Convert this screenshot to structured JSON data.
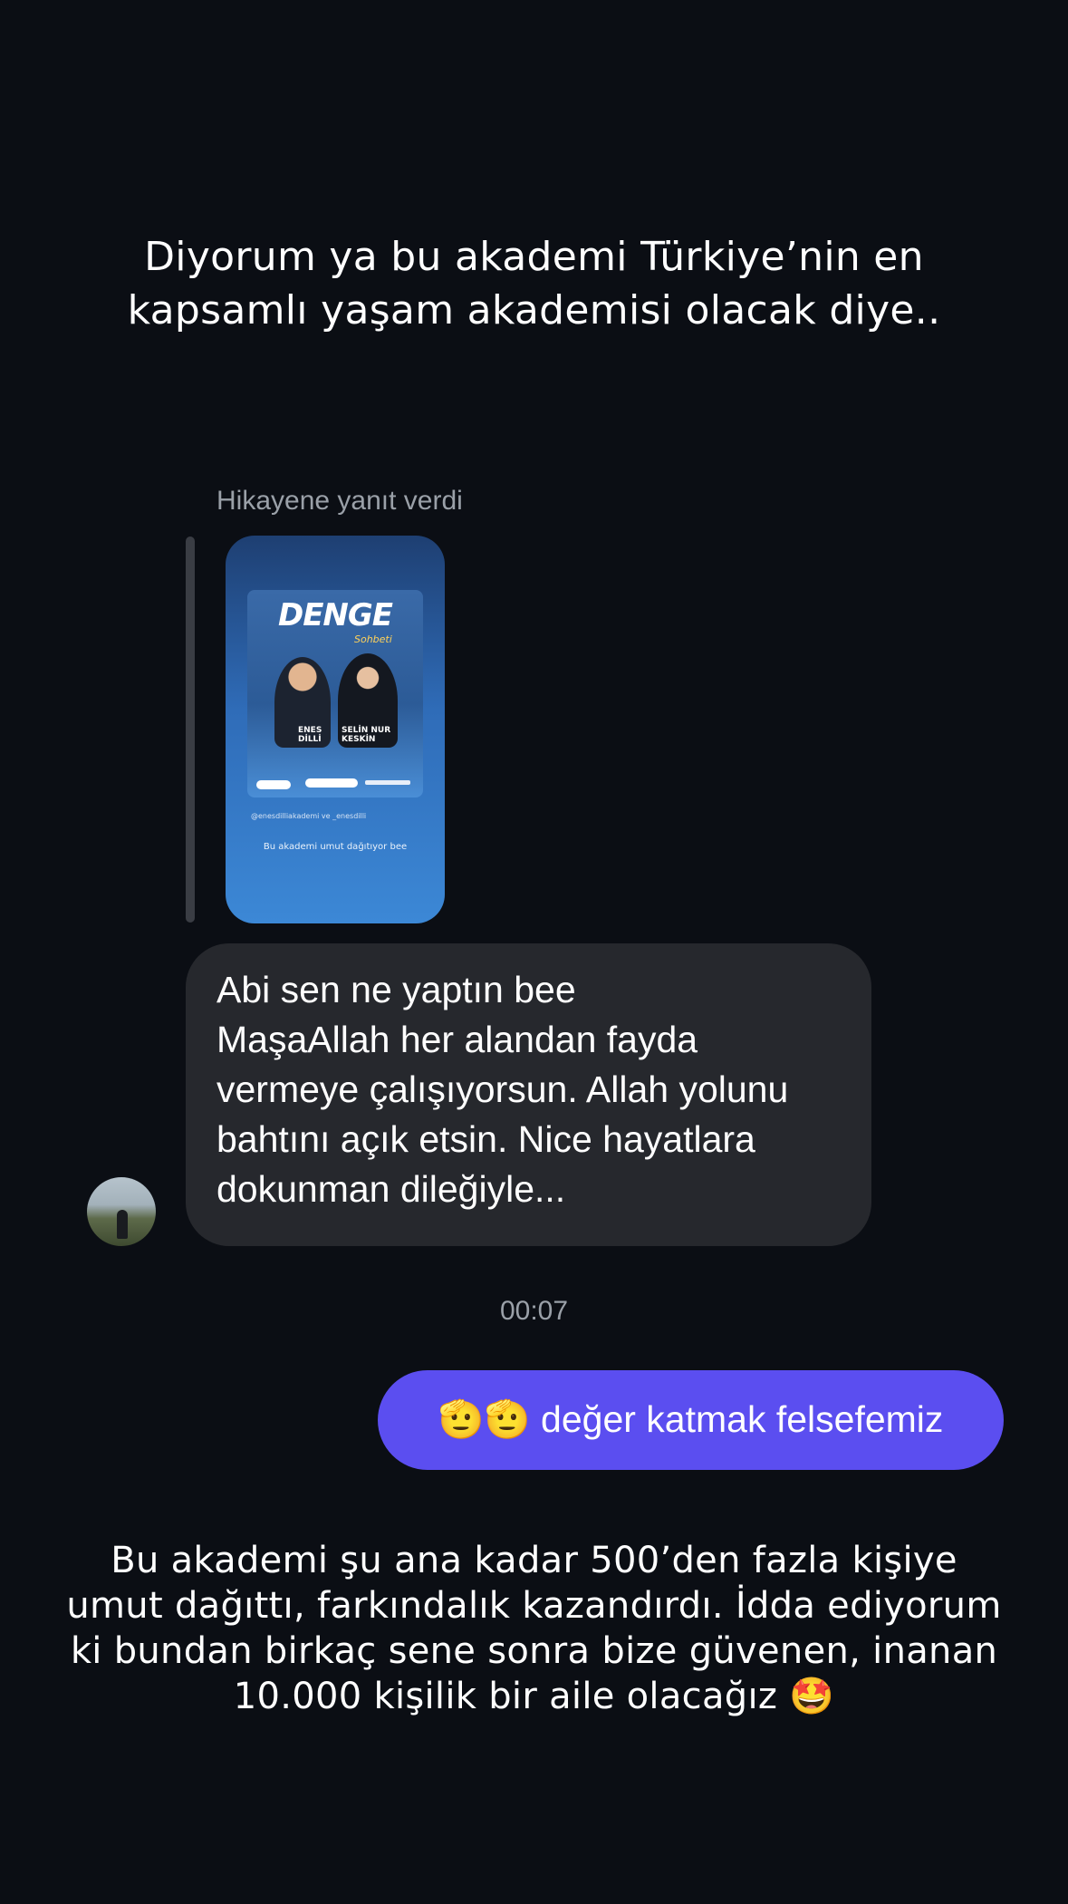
{
  "caption_top": {
    "line1": "Diyorum ya bu akademi Türkiye’nin en",
    "line2": "kapsamlı yaşam akademisi olacak diye.."
  },
  "reply": {
    "label": "Hikayene yanıt verdi",
    "story": {
      "poster_title": "DENGE",
      "poster_subtitle": "Sohbeti",
      "name_left": "ENES DİLLİ",
      "name_right": "SELİN NUR KESKİN",
      "mention": "@enesdilliakademi ve _enesdilli",
      "caption": "Bu akademi umut dağıtıyor bee"
    }
  },
  "incoming_message": {
    "line1": "Abi sen ne yaptın bee",
    "line2": "MaşaAllah her alandan fayda",
    "line3": "vermeye çalışıyorsun. Allah yolunu",
    "line4": "bahtını açık etsin. Nice hayatlara",
    "line5": "dokunman dileğiyle..."
  },
  "timestamp": "00:07",
  "outgoing_message": "🫡🫡 değer katmak felsefemiz",
  "caption_bottom": {
    "line1": "Bu akademi şu ana kadar 500’den fazla kişiye",
    "line2": "umut dağıttı, farkındalık kazandırdı. İdda ediyorum",
    "line3": "ki bundan birkaç sene sonra bize güvenen, inanan",
    "line4": "10.000 kişilik bir aile olacağız 🤩"
  },
  "colors": {
    "background": "#0b0e14",
    "incoming_bubble": "#26282d",
    "outgoing_bubble": "#5b4ef0",
    "muted_text": "#9aa0a8"
  }
}
